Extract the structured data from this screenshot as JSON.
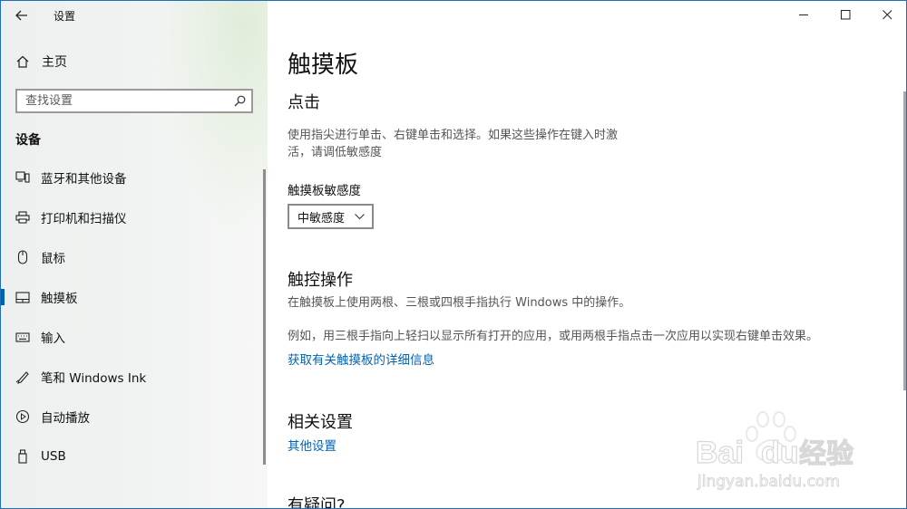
{
  "window": {
    "title": "设置",
    "controls": {
      "minimize": "—",
      "maximize": "☐",
      "close": "✕"
    }
  },
  "sidebar": {
    "home": "主页",
    "search_placeholder": "查找设置",
    "section": "设备",
    "items": [
      {
        "label": "蓝牙和其他设备",
        "icon": "bluetooth-devices-icon"
      },
      {
        "label": "打印机和扫描仪",
        "icon": "printer-icon"
      },
      {
        "label": "鼠标",
        "icon": "mouse-icon"
      },
      {
        "label": "触摸板",
        "icon": "touchpad-icon",
        "active": true
      },
      {
        "label": "输入",
        "icon": "keyboard-icon"
      },
      {
        "label": "笔和 Windows Ink",
        "icon": "pen-icon"
      },
      {
        "label": "自动播放",
        "icon": "autoplay-icon"
      },
      {
        "label": "USB",
        "icon": "usb-icon"
      }
    ]
  },
  "main": {
    "title": "触摸板",
    "tap": {
      "heading": "点击",
      "desc_line1": "使用指尖进行单击、右键单击和选择。如果这些操作在键入时激",
      "desc_line2": "活，请调低敏感度",
      "sensitivity_label": "触摸板敏感度",
      "sensitivity_value": "中敏感度"
    },
    "gestures": {
      "heading": "触控操作",
      "desc1": "在触摸板上使用两根、三根或四根手指执行 Windows 中的操作。",
      "desc2": "例如，用三根手指向上轻扫以显示所有打开的应用，或用两根手指点击一次应用以实现右键单击效果。",
      "link": "获取有关触摸板的详细信息"
    },
    "related": {
      "heading": "相关设置",
      "link": "其他设置"
    },
    "help": {
      "heading": "有疑问?"
    }
  },
  "watermark": {
    "brand": "Bai",
    "brand2": "du",
    "product": "经验",
    "url": "jingyan.baidu.com"
  }
}
